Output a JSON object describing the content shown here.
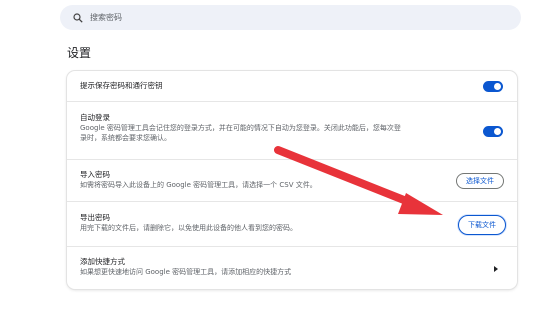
{
  "search": {
    "placeholder": "搜索密码"
  },
  "settings": {
    "title": "设置",
    "rows": [
      {
        "title": "提示保存密码和通行密钥",
        "toggle_on": true
      },
      {
        "title": "自动登录",
        "description": "Google 密码管理工具会记住您的登录方式，并在可能的情况下自动为您登录。关闭此功能后，您每次登\n录时，系统都会要求您确认。",
        "toggle_on": true
      },
      {
        "title": "导入密码",
        "description": "如需将密码导入此设备上的 Google 密码管理工具，请选择一个 CSV 文件。",
        "button": "选择文件"
      },
      {
        "title": "导出密码",
        "description": "用完下载的文件后，请删除它，以免使用此设备的他人看到您的密码。",
        "button": "下载文件"
      },
      {
        "title": "添加快捷方式",
        "description": "如果想更快速地访问 Google 密码管理工具，请添加相应的快捷方式"
      }
    ]
  },
  "colors": {
    "accent": "#0b57d0",
    "annotation_arrow": "#e8333a"
  }
}
